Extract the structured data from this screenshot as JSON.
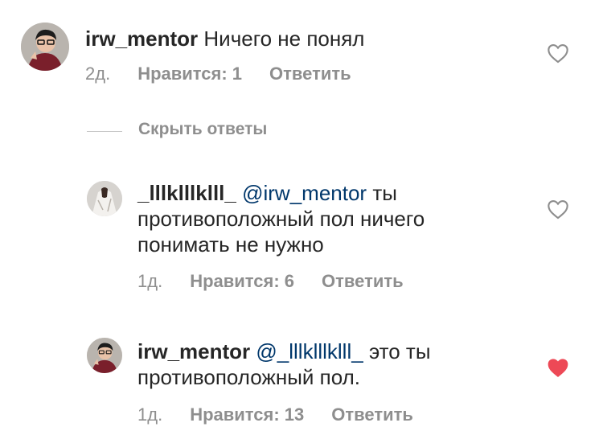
{
  "comments": [
    {
      "username": "irw_mentor",
      "lines": [
        "Ничего не понял"
      ],
      "time": "2д.",
      "likes": "Нравится: 1",
      "reply": "Ответить",
      "liked": false
    },
    {
      "username": "_lllklllklll_",
      "mention": "@irw_mentor",
      "lines": [
        "ты",
        "противоположный пол ничего",
        "понимать не нужно"
      ],
      "time": "1д.",
      "likes": "Нравится: 6",
      "reply": "Ответить",
      "liked": false
    },
    {
      "username": "irw_mentor",
      "mention": "@_lllklllklll_",
      "lines": [
        "это ты",
        "противоположный пол."
      ],
      "time": "1д.",
      "likes": "Нравится: 13",
      "reply": "Ответить",
      "liked": true
    }
  ],
  "hide_replies_label": "Скрыть ответы",
  "colors": {
    "heart_liked": "#ed4956",
    "heart_outline": "#8e8e8e",
    "mention": "#00376b",
    "meta": "#8e8e8e"
  }
}
